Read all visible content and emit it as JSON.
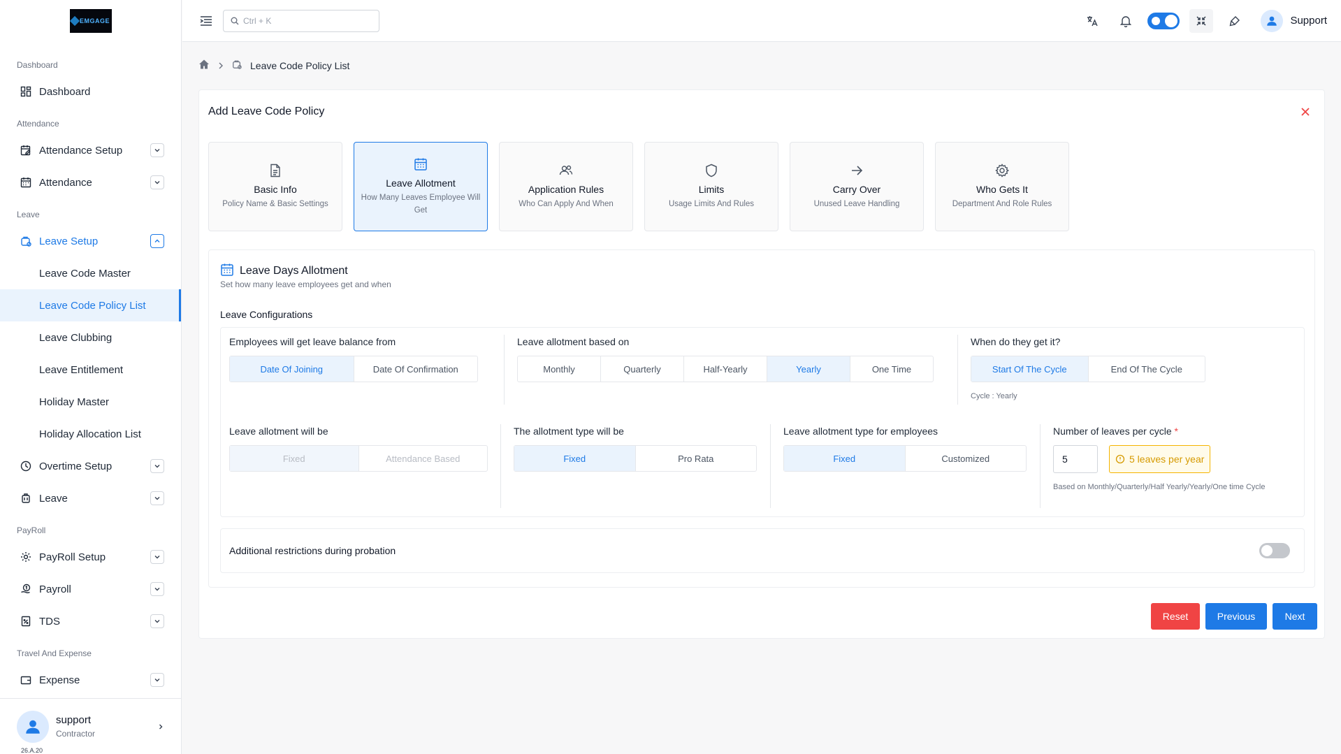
{
  "app": {
    "logo_text": "EMGAGE"
  },
  "colors": {
    "accent": "#1e7ae6",
    "danger": "#f04444",
    "warning": "#f5b400"
  },
  "search": {
    "placeholder": "Ctrl + K"
  },
  "topbar": {
    "user_label": "Support"
  },
  "sidebar": {
    "sections": {
      "dashboard": "Dashboard",
      "attendance": "Attendance",
      "leave": "Leave",
      "payroll": "PayRoll",
      "travel": "Travel And Expense"
    },
    "items": {
      "dashboard": "Dashboard",
      "attendance_setup": "Attendance Setup",
      "attendance": "Attendance",
      "leave_setup": "Leave Setup",
      "overtime_setup": "Overtime Setup",
      "leave": "Leave",
      "payroll_setup": "PayRoll Setup",
      "payroll": "Payroll",
      "tds": "TDS",
      "expense": "Expense"
    },
    "leave_sub": {
      "code_master": "Leave Code Master",
      "policy_list": "Leave Code Policy List",
      "clubbing": "Leave Clubbing",
      "entitlement": "Leave Entitlement",
      "holiday_master": "Holiday Master",
      "holiday_allocation": "Holiday Allocation List"
    },
    "user": {
      "name": "support",
      "role": "Contractor",
      "version": "26.A.20"
    }
  },
  "breadcrumb": {
    "current": "Leave Code Policy List"
  },
  "form": {
    "title": "Add Leave Code Policy",
    "steps": [
      {
        "title": "Basic Info",
        "sub": "Policy Name & Basic Settings",
        "icon": "document-icon"
      },
      {
        "title": "Leave Allotment",
        "sub": "How Many Leaves Employee Will Get",
        "icon": "calendar-icon"
      },
      {
        "title": "Application Rules",
        "sub": "Who Can Apply And When",
        "icon": "users-icon"
      },
      {
        "title": "Limits",
        "sub": "Usage Limits And Rules",
        "icon": "shield-icon"
      },
      {
        "title": "Carry Over",
        "sub": "Unused Leave Handling",
        "icon": "arrow-right-icon"
      },
      {
        "title": "Who Gets It",
        "sub": "Department And Role Rules",
        "icon": "gear-icon"
      }
    ],
    "active_step": 1,
    "section": {
      "title": "Leave Days Allotment",
      "subtitle": "Set how many leave employees get and when",
      "config_label": "Leave Configurations",
      "balance_from": {
        "label": "Employees will get leave balance from",
        "options": [
          "Date Of Joining",
          "Date Of Confirmation"
        ],
        "selected": "Date Of Joining"
      },
      "allotment_basis": {
        "label": "Leave allotment based on",
        "options": [
          "Monthly",
          "Quarterly",
          "Half-Yearly",
          "Yearly",
          "One Time"
        ],
        "selected": "Yearly"
      },
      "when": {
        "label": "When do they get it?",
        "options": [
          "Start Of The Cycle",
          "End Of The Cycle"
        ],
        "selected": "Start Of The Cycle",
        "note": "Cycle : Yearly"
      },
      "allotment_will_be": {
        "label": "Leave allotment will be",
        "options": [
          "Fixed",
          "Attendance Based"
        ],
        "selected": "Fixed"
      },
      "allotment_type": {
        "label": "The allotment type will be",
        "options": [
          "Fixed",
          "Pro Rata"
        ],
        "selected": "Fixed"
      },
      "type_for_employees": {
        "label": "Leave allotment type for employees",
        "options": [
          "Fixed",
          "Customized"
        ],
        "selected": "Fixed"
      },
      "leaves_per_cycle": {
        "label": "Number of leaves per cycle",
        "required_mark": "*",
        "value": "5",
        "badge": "5 leaves per year",
        "note": "Based on Monthly/Quarterly/Half Yearly/Yearly/One time Cycle"
      },
      "probation": {
        "label": "Additional restrictions during probation",
        "enabled": false
      }
    },
    "buttons": {
      "reset": "Reset",
      "previous": "Previous",
      "next": "Next"
    }
  }
}
